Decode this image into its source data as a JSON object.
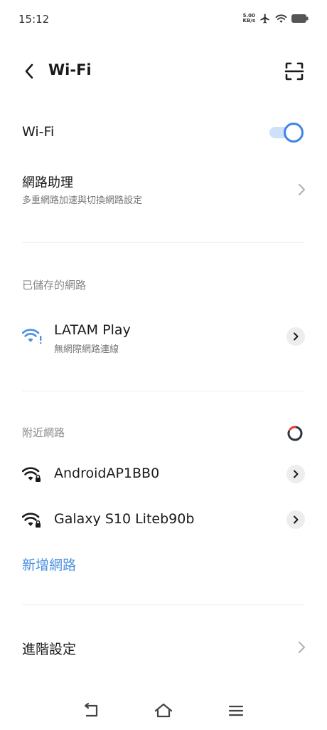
{
  "status_bar": {
    "time": "15:12",
    "speed_value": "5.00",
    "speed_unit": "KB/s",
    "icons": [
      "airplane-icon",
      "wifi-icon",
      "battery-icon"
    ]
  },
  "header": {
    "title": "Wi-Fi",
    "back_icon": "chevron-left-icon",
    "scan_icon": "scan-icon"
  },
  "wifi_toggle": {
    "label": "Wi-Fi",
    "enabled": true
  },
  "network_assistant": {
    "title": "網路助理",
    "subtitle": "多重網路加速與切換網路設定"
  },
  "saved_networks": {
    "section_label": "已儲存的網路",
    "items": [
      {
        "name": "LATAM Play",
        "status": "無網際網路連線"
      }
    ]
  },
  "nearby_networks": {
    "section_label": "附近網路",
    "items": [
      {
        "name": "AndroidAP1BB0"
      },
      {
        "name": "Galaxy S10 Liteb90b"
      }
    ]
  },
  "add_network_label": "新增網路",
  "advanced_settings_label": "進階設定",
  "colors": {
    "accent": "#4a8fe0",
    "toggle_knob": "#3f84ea",
    "toggle_track": "#cfe0fb",
    "spinner_red": "#e53935"
  }
}
